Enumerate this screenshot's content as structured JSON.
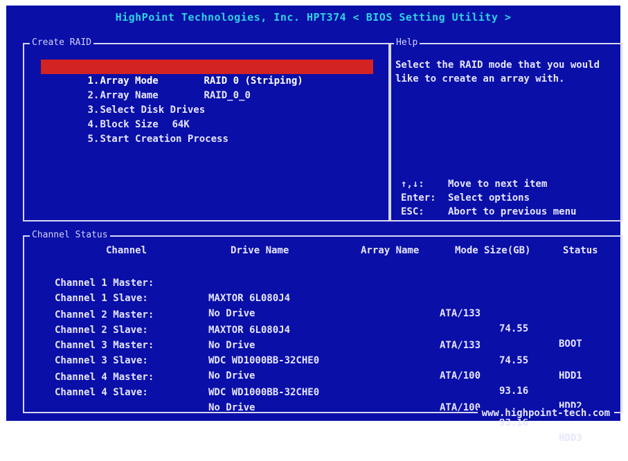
{
  "title": "HighPoint Technologies, Inc. HPT374 < BIOS Setting Utility >",
  "create_raid": {
    "label": "Create RAID",
    "items": [
      {
        "index": "1.",
        "name": "Array Mode",
        "value": "RAID 0 (Striping)",
        "selected": true
      },
      {
        "index": "2.",
        "name": "Array Name",
        "value": "RAID_0_0",
        "selected": false
      },
      {
        "index": "3.",
        "name": "Select Disk Drives",
        "value": "",
        "selected": false
      },
      {
        "index": "4.",
        "name": "Block Size",
        "value": "64K",
        "selected": false
      },
      {
        "index": "5.",
        "name": "Start Creation Process",
        "value": "",
        "selected": false
      }
    ]
  },
  "help": {
    "label": "Help",
    "text": "Select the RAID mode that you would like to create an array with.",
    "keys": [
      {
        "key": "↑,↓:",
        "desc": "Move to next item"
      },
      {
        "key": "Enter:",
        "desc": "Select options"
      },
      {
        "key": "ESC:",
        "desc": "Abort to previous menu"
      }
    ]
  },
  "channel_status": {
    "label": "Channel Status",
    "headers": {
      "channel": "Channel",
      "drive": "Drive Name",
      "array": "Array Name",
      "mode": "Mode",
      "size": "Size(GB)",
      "status": "Status"
    },
    "rows": [
      {
        "channel": "Channel 1 Master:",
        "drive": "MAXTOR 6L080J4",
        "mode": "ATA/133",
        "size": "74.55",
        "status": "BOOT"
      },
      {
        "channel": "Channel 1 Slave:",
        "drive": "No Drive",
        "mode": "",
        "size": "",
        "status": ""
      },
      {
        "channel": "Channel 2 Master:",
        "drive": "MAXTOR 6L080J4",
        "mode": "ATA/133",
        "size": "74.55",
        "status": "HDD1"
      },
      {
        "channel": "Channel 2 Slave:",
        "drive": "No Drive",
        "mode": "",
        "size": "",
        "status": ""
      },
      {
        "channel": "Channel 3 Master:",
        "drive": "WDC WD1000BB-32CHE0",
        "mode": "ATA/100",
        "size": "93.16",
        "status": "HDD2"
      },
      {
        "channel": "Channel 3 Slave:",
        "drive": "No Drive",
        "mode": "",
        "size": "",
        "status": ""
      },
      {
        "channel": "Channel 4 Master:",
        "drive": "WDC WD1000BB-32CHE0",
        "mode": "ATA/100",
        "size": "93.16",
        "status": "HDD3"
      },
      {
        "channel": "Channel 4 Slave:",
        "drive": "No Drive",
        "mode": "",
        "size": "",
        "status": ""
      }
    ]
  },
  "footer": "www.highpoint-tech.com",
  "colors": {
    "background": "#0a0fa8",
    "title": "#2fd3e0",
    "selection": "#d32323",
    "text": "#e6e6ff"
  }
}
